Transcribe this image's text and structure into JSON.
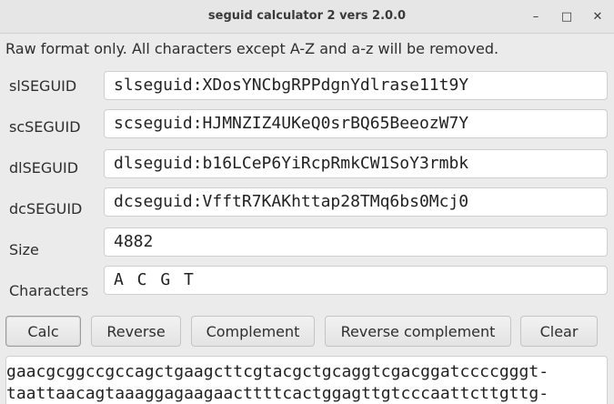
{
  "window": {
    "title": "seguid calculator 2 vers 2.0.0",
    "minimize_glyph": "–",
    "maximize_glyph": "□",
    "close_glyph": "✕"
  },
  "info_text": "Raw format only. All characters except A-Z and a-z will be removed.",
  "fields": {
    "slseguid": {
      "label": "slSEGUID",
      "value": "slseguid:XDosYNCbgRPPdgnYdlrase11t9Y"
    },
    "scseguid": {
      "label": "scSEGUID",
      "value": "scseguid:HJMNZIZ4UKeQ0srBQ65BeeozW7Y"
    },
    "dlseguid": {
      "label": "dlSEGUID",
      "value": "dlseguid:b16LCeP6YiRcpRmkCW1SoY3rmbk"
    },
    "dcseguid": {
      "label": "dcSEGUID",
      "value": "dcseguid:VfftR7KAKhttap28TMq6bs0Mcj0"
    },
    "size": {
      "label": "Size",
      "value": "4882"
    },
    "characters": {
      "label": "Characters",
      "value": "A C G T"
    }
  },
  "buttons": {
    "calc": "Calc",
    "reverse": "Reverse",
    "complement": "Complement",
    "reverse_complement": "Reverse complement",
    "clear": "Clear"
  },
  "sequence": {
    "line1": "gaacgcggccgccagctgaagcttcgtacgctgcaggtcgacggatccccgggt-",
    "line2": "taattaacagtaaaggagaagaacttttcactggagttgtcccaattcttgttg-"
  }
}
